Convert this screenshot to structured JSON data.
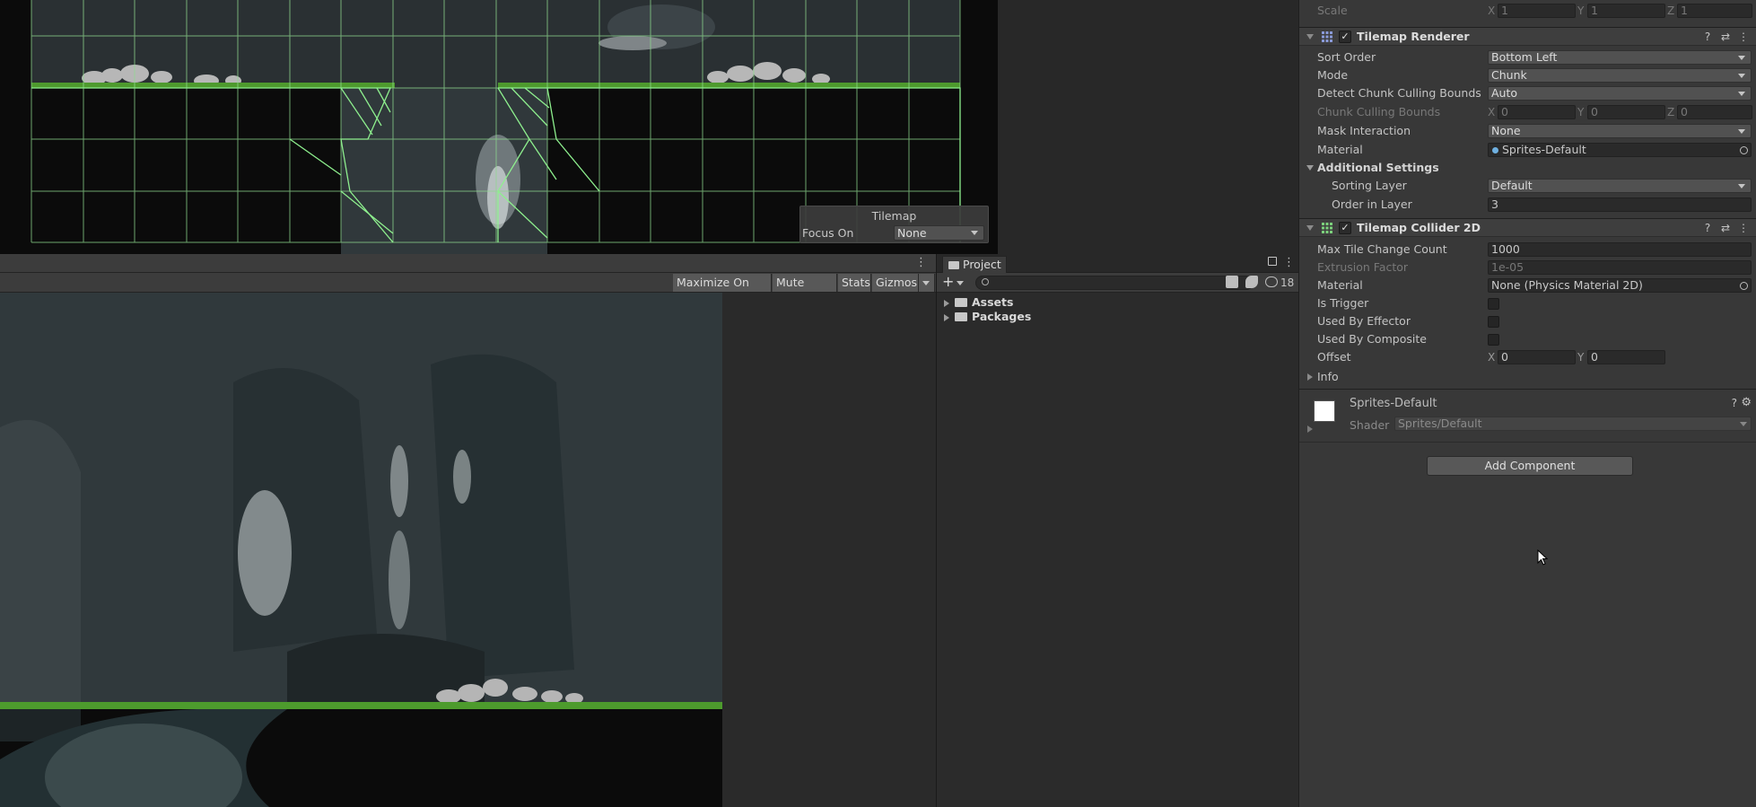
{
  "scene_overlay": {
    "title": "Tilemap",
    "focus_label": "Focus On",
    "focus_value": "None"
  },
  "game_toolbar": {
    "maximize": "Maximize On Play",
    "mute": "Mute Audio",
    "stats": "Stats",
    "gizmos": "Gizmos"
  },
  "project": {
    "tab_label": "Project",
    "search_placeholder": "",
    "hidden_count": "18",
    "tree": [
      {
        "label": "Assets"
      },
      {
        "label": "Packages"
      }
    ]
  },
  "inspector": {
    "scale": {
      "label": "Scale",
      "x": "1",
      "y": "1",
      "z": "1"
    },
    "tilemap_renderer": {
      "title": "Tilemap Renderer",
      "sort_order": {
        "label": "Sort Order",
        "value": "Bottom Left"
      },
      "mode": {
        "label": "Mode",
        "value": "Chunk"
      },
      "detect_culling": {
        "label": "Detect Chunk Culling Bounds",
        "value": "Auto"
      },
      "chunk_culling": {
        "label": "Chunk Culling Bounds",
        "x": "0",
        "y": "0",
        "z": "0"
      },
      "mask_interaction": {
        "label": "Mask Interaction",
        "value": "None"
      },
      "material": {
        "label": "Material",
        "value": "Sprites-Default"
      },
      "additional": {
        "label": "Additional Settings"
      },
      "sorting_layer": {
        "label": "Sorting Layer",
        "value": "Default"
      },
      "order_in_layer": {
        "label": "Order in Layer",
        "value": "3"
      }
    },
    "tilemap_collider": {
      "title": "Tilemap Collider 2D",
      "max_tile": {
        "label": "Max Tile Change Count",
        "value": "1000"
      },
      "extrusion": {
        "label": "Extrusion Factor",
        "value": "1e-05"
      },
      "material": {
        "label": "Material",
        "value": "None (Physics Material 2D)"
      },
      "is_trigger": {
        "label": "Is Trigger"
      },
      "used_by_effector": {
        "label": "Used By Effector"
      },
      "used_by_composite": {
        "label": "Used By Composite"
      },
      "offset": {
        "label": "Offset",
        "x": "0",
        "y": "0"
      },
      "info": {
        "label": "Info"
      }
    },
    "material_preview": {
      "name": "Sprites-Default",
      "shader_label": "Shader",
      "shader_value": "Sprites/Default"
    },
    "add_component": "Add Component"
  },
  "axis": {
    "x": "X",
    "y": "Y",
    "z": "Z"
  }
}
